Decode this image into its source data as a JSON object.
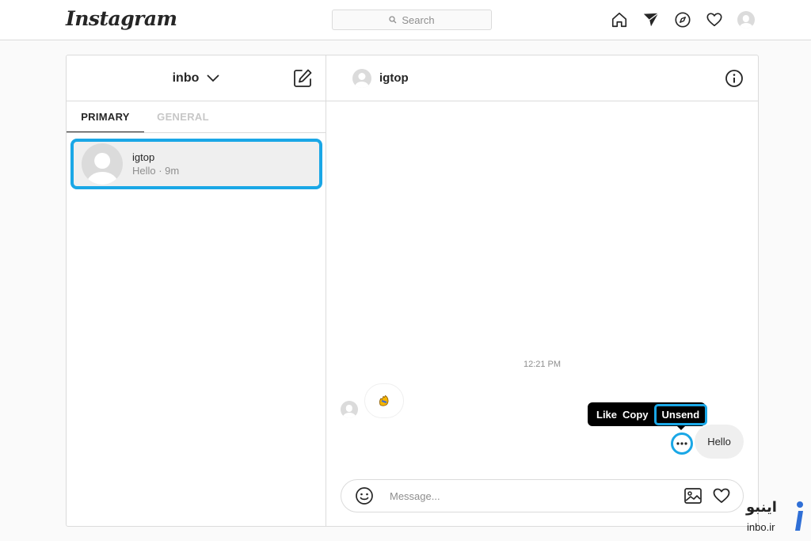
{
  "topbar": {
    "logo": "Instagram",
    "search_placeholder": "Search",
    "icons": [
      "home-icon",
      "direct-icon",
      "explore-icon",
      "activity-heart-icon",
      "profile-avatar"
    ]
  },
  "inbox": {
    "account": "inbo",
    "tabs": [
      {
        "label": "PRIMARY",
        "active": true
      },
      {
        "label": "GENERAL",
        "active": false
      }
    ],
    "threads": [
      {
        "name": "igtop",
        "preview": "Hello · 9m",
        "selected": true
      }
    ]
  },
  "chat": {
    "title": "igtop",
    "timestamp": "12:21 PM",
    "messages": [
      {
        "from": "them",
        "content": "wave-emoji"
      },
      {
        "from": "me",
        "content": "Hello"
      }
    ],
    "context_menu": {
      "like": "Like",
      "copy": "Copy",
      "unsend": "Unsend"
    },
    "composer": {
      "placeholder": "Message..."
    }
  },
  "watermark": {
    "fa": "اینبو",
    "en": "inbo.ir"
  },
  "colors": {
    "highlight": "#1aa7e6",
    "border": "#dbdbdb",
    "muted": "#8e8e8e"
  }
}
